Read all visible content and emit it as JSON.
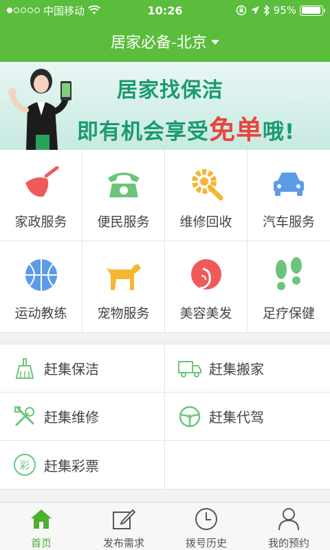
{
  "status_bar": {
    "carrier": "中国移动",
    "time": "10:26",
    "battery": "95%",
    "battery_level": 0.95
  },
  "header": {
    "title": "居家必备-北京"
  },
  "banner": {
    "line1": "居家找保洁",
    "line2_prefix": "即有机会享受",
    "line2_highlight": "免单",
    "line2_suffix": "哦!"
  },
  "categories": [
    {
      "label": "家政服务",
      "icon": "broom-icon",
      "color": "#ee5a5a"
    },
    {
      "label": "便民服务",
      "icon": "telephone-icon",
      "color": "#6cc57a"
    },
    {
      "label": "维修回收",
      "icon": "gear-wrench-icon",
      "color": "#f5b731"
    },
    {
      "label": "汽车服务",
      "icon": "car-icon",
      "color": "#5b9be8"
    },
    {
      "label": "运动教练",
      "icon": "basketball-icon",
      "color": "#5b9be8"
    },
    {
      "label": "宠物服务",
      "icon": "dog-icon",
      "color": "#f5b731"
    },
    {
      "label": "美容美发",
      "icon": "hair-icon",
      "color": "#ee5a5a"
    },
    {
      "label": "足疗保健",
      "icon": "footprint-icon",
      "color": "#6cc57a"
    }
  ],
  "quick_links": [
    {
      "label": "赶集保洁",
      "icon": "cleaning-brush-icon"
    },
    {
      "label": "赶集搬家",
      "icon": "truck-icon"
    },
    {
      "label": "赶集维修",
      "icon": "tools-icon"
    },
    {
      "label": "赶集代驾",
      "icon": "steering-wheel-icon"
    },
    {
      "label": "赶集彩票",
      "icon": "lottery-icon",
      "icon_text": "彩"
    }
  ],
  "tabs": [
    {
      "label": "首页",
      "icon": "home-icon",
      "active": true
    },
    {
      "label": "发布需求",
      "icon": "edit-icon",
      "active": false
    },
    {
      "label": "拨号历史",
      "icon": "clock-icon",
      "active": false
    },
    {
      "label": "我的预约",
      "icon": "user-icon",
      "active": false
    }
  ],
  "colors": {
    "brand_green": "#5abd3c",
    "active_tab": "#4caf2e"
  }
}
